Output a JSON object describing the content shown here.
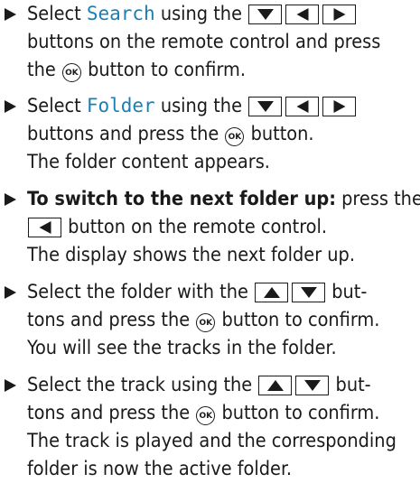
{
  "accent_color": "#1a7fb4",
  "icons": {
    "bullet": "right-triangle-bullet",
    "down": "down-arrow-button",
    "up": "up-arrow-button",
    "left": "left-arrow-button",
    "right": "right-arrow-button",
    "ok": "ok-button"
  },
  "ok_label": "OK",
  "steps": [
    {
      "l1_pre": "Select ",
      "l1_hl": "Search",
      "l1_post": " using the",
      "l2": "buttons on the remote control and press",
      "l3_pre": "the",
      "l3_post": "button to confirm."
    },
    {
      "l1_pre": "Select ",
      "l1_hl": "Folder",
      "l1_post": " using the",
      "l2_pre": "buttons and press the",
      "l2_post": "button.",
      "l3": "The folder content appears."
    },
    {
      "l1_bold": "To switch to the next folder up:",
      "l1_post": " press the",
      "l2_post": "button on the remote control.",
      "l3": "The display shows the next folder up."
    },
    {
      "l1_pre": "Select the folder with the",
      "l1_post": "but-",
      "l2_pre": "tons and press the",
      "l2_post": "button to confirm.",
      "l3": "You will see the tracks in the folder."
    },
    {
      "l1_pre": "Select the track using the",
      "l1_post": "but-",
      "l2_pre": "tons and press the",
      "l2_post": "button to confirm.",
      "l3": "The track is played and the corresponding",
      "l4": "folder is now the active folder."
    }
  ]
}
